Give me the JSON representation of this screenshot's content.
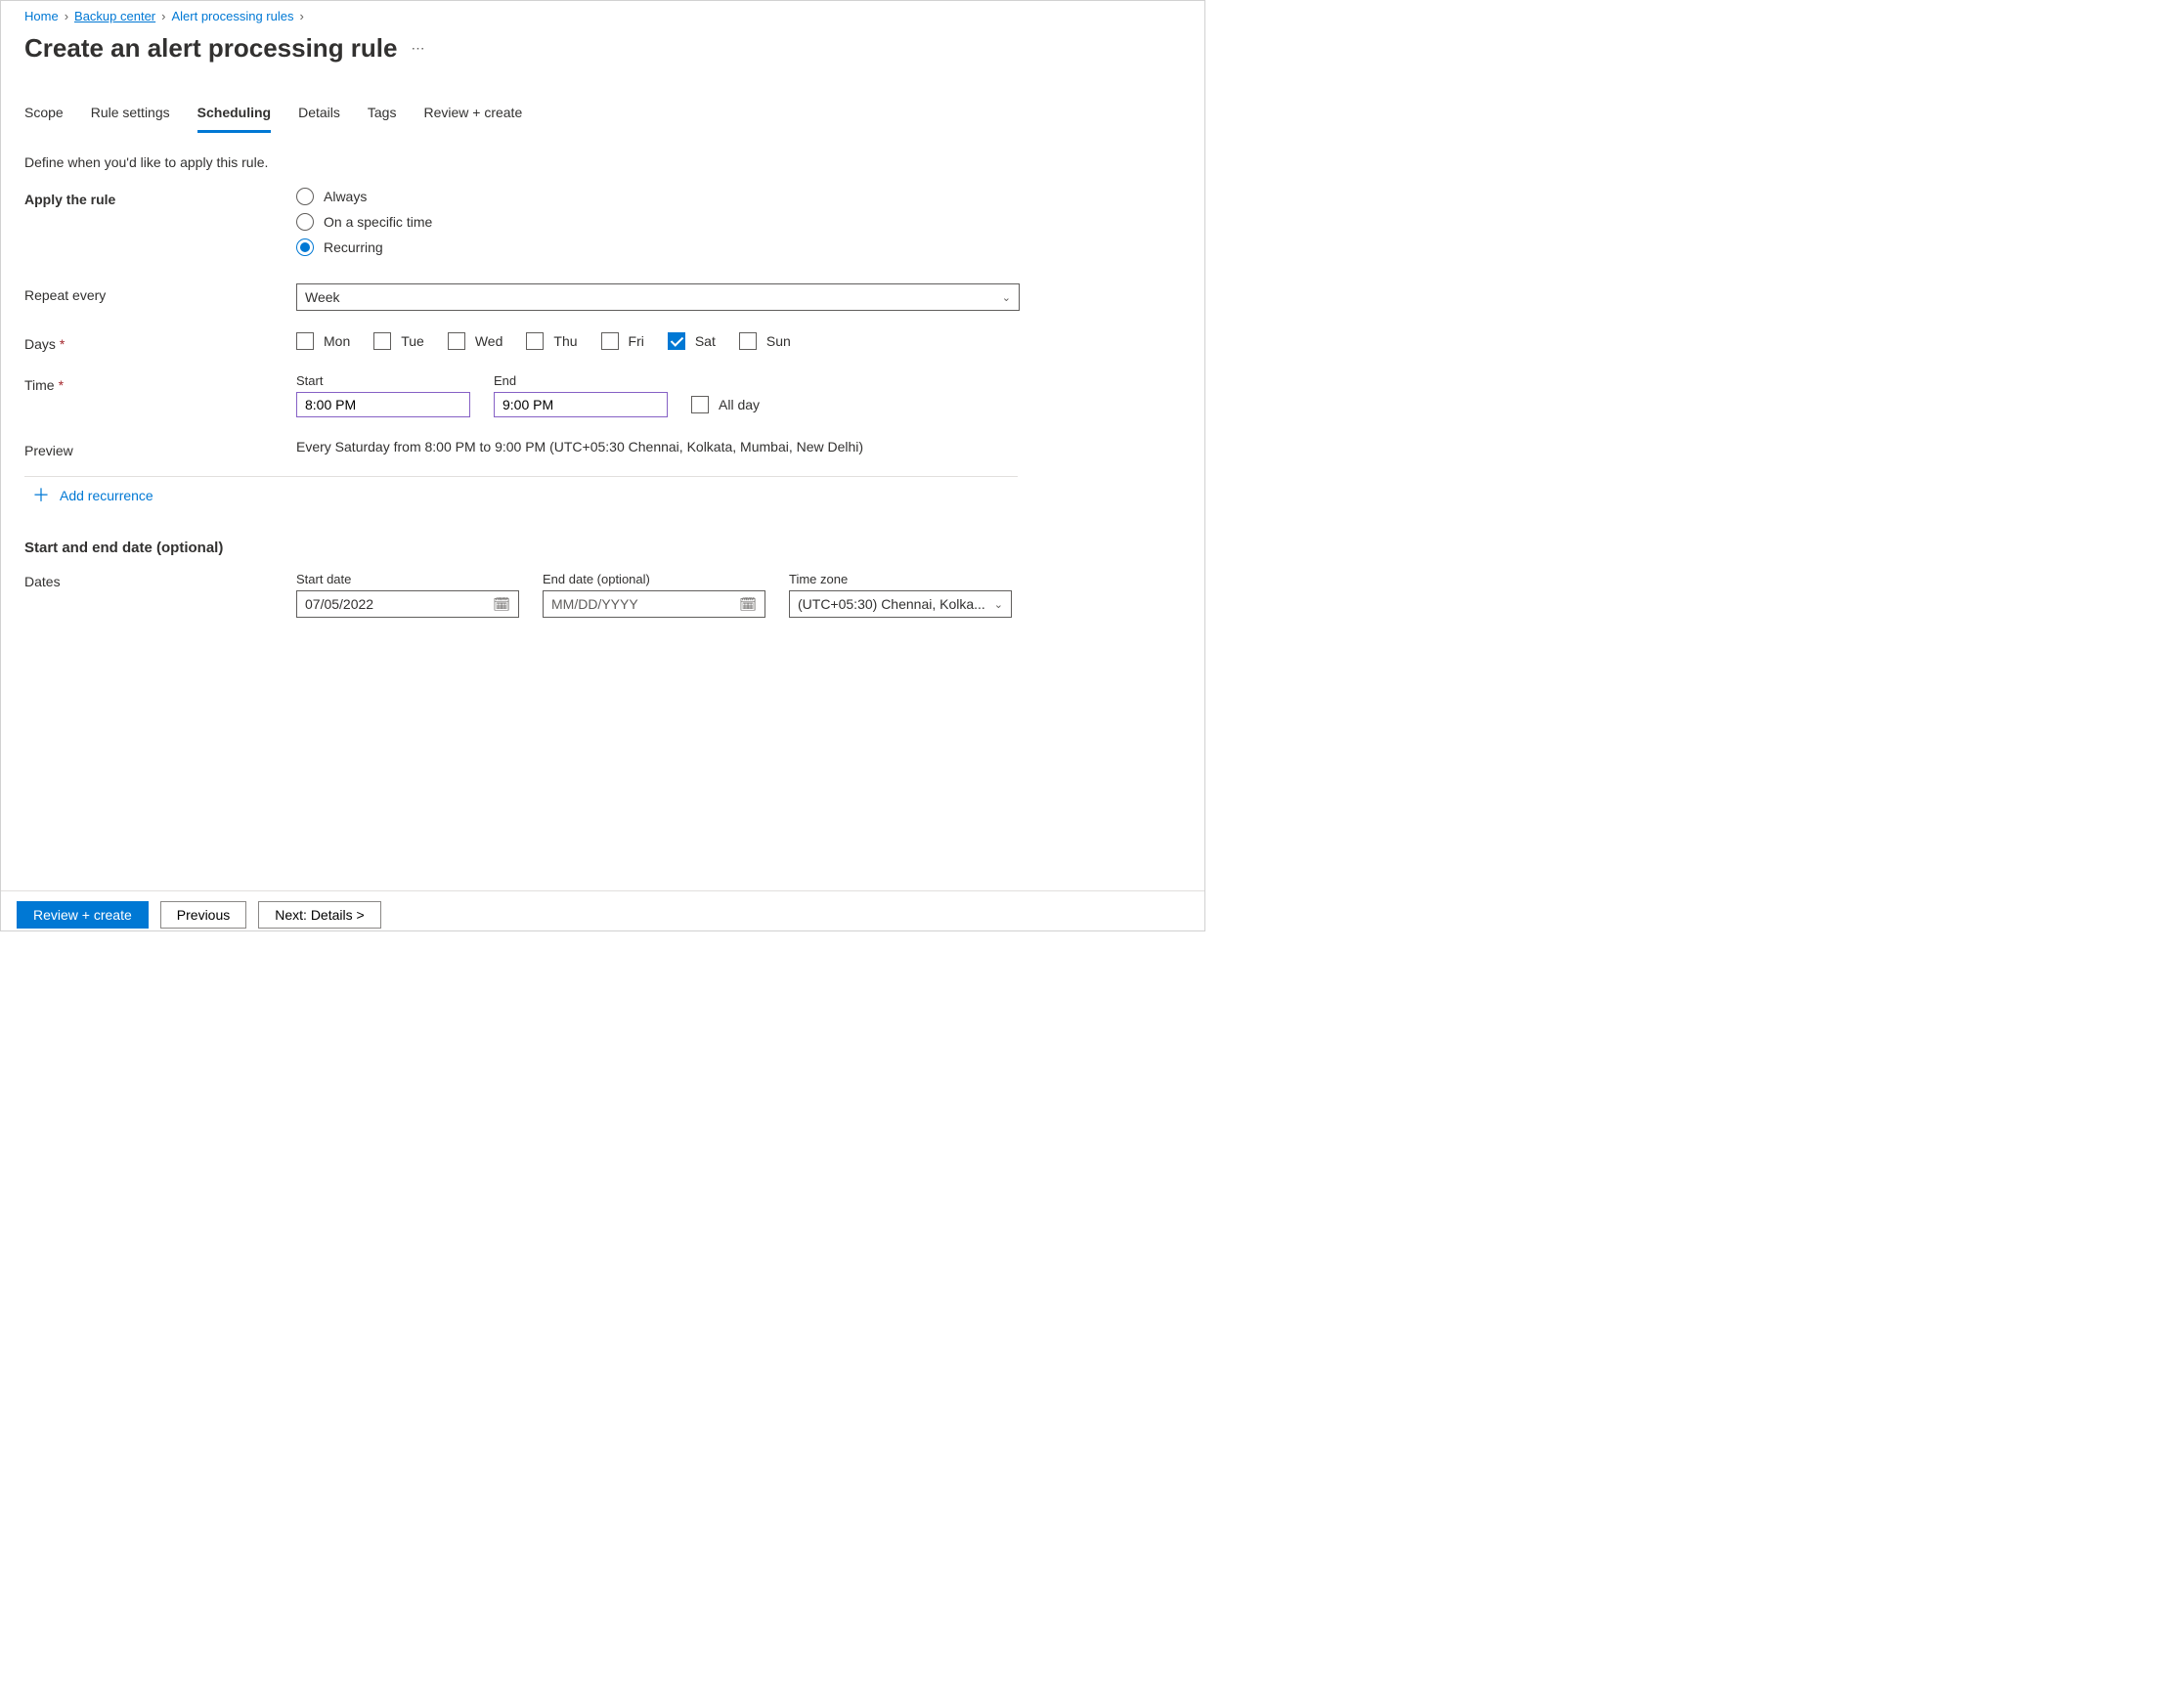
{
  "breadcrumbs": [
    {
      "label": "Home",
      "underline": false
    },
    {
      "label": "Backup center",
      "underline": true
    },
    {
      "label": "Alert processing rules",
      "underline": false
    }
  ],
  "page_title": "Create an alert processing rule",
  "tabs": [
    {
      "label": "Scope",
      "active": false
    },
    {
      "label": "Rule settings",
      "active": false
    },
    {
      "label": "Scheduling",
      "active": true
    },
    {
      "label": "Details",
      "active": false
    },
    {
      "label": "Tags",
      "active": false
    },
    {
      "label": "Review + create",
      "active": false
    }
  ],
  "helper_text": "Define when you'd like to apply this rule.",
  "labels": {
    "apply_rule": "Apply the rule",
    "repeat_every": "Repeat every",
    "days": "Days",
    "time": "Time",
    "preview": "Preview",
    "add_recurrence": "Add recurrence",
    "section_dates": "Start and end date (optional)",
    "dates": "Dates",
    "start": "Start",
    "end": "End",
    "all_day": "All day",
    "start_date": "Start date",
    "end_date": "End date (optional)",
    "time_zone": "Time zone"
  },
  "apply_options": [
    {
      "label": "Always",
      "checked": false
    },
    {
      "label": "On a specific time",
      "checked": false
    },
    {
      "label": "Recurring",
      "checked": true
    }
  ],
  "repeat_value": "Week",
  "days": [
    {
      "label": "Mon",
      "checked": false
    },
    {
      "label": "Tue",
      "checked": false
    },
    {
      "label": "Wed",
      "checked": false
    },
    {
      "label": "Thu",
      "checked": false
    },
    {
      "label": "Fri",
      "checked": false
    },
    {
      "label": "Sat",
      "checked": true
    },
    {
      "label": "Sun",
      "checked": false
    }
  ],
  "time": {
    "start": "8:00 PM",
    "end": "9:00 PM",
    "all_day": false
  },
  "preview_text": "Every Saturday from 8:00 PM to 9:00 PM (UTC+05:30 Chennai, Kolkata, Mumbai, New Delhi)",
  "dates": {
    "start_date": "07/05/2022",
    "end_date_placeholder": "MM/DD/YYYY",
    "time_zone": "(UTC+05:30) Chennai, Kolka..."
  },
  "footer": {
    "primary": "Review + create",
    "previous": "Previous",
    "next": "Next: Details >"
  }
}
